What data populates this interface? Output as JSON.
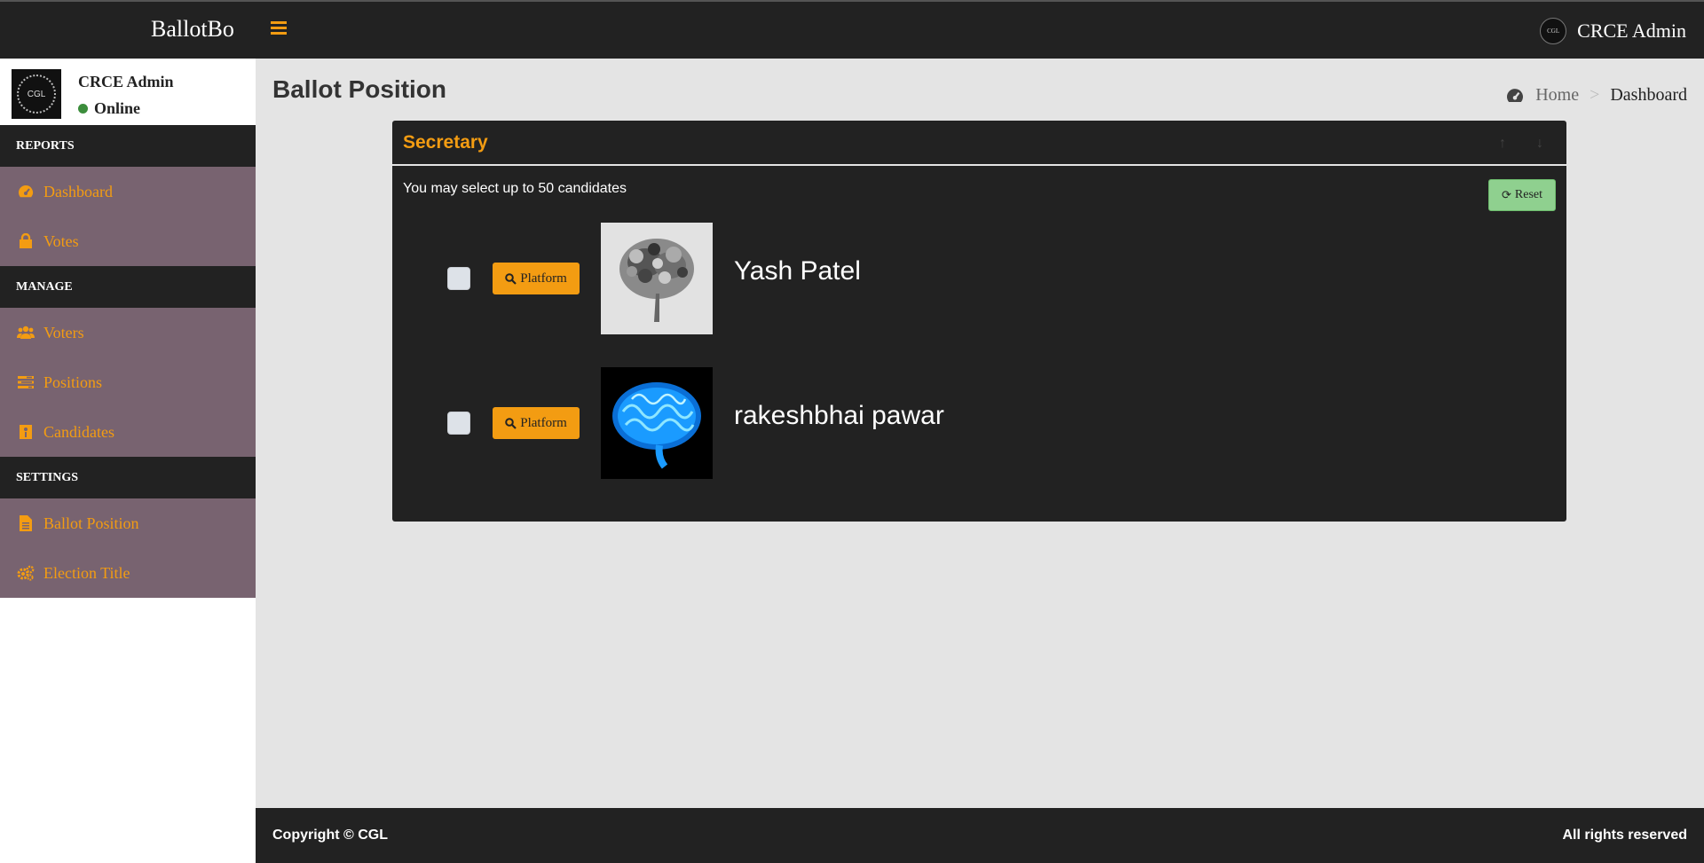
{
  "app": {
    "brand": "BallotBo",
    "user": "CRCE Admin",
    "avatar_text": "CGL"
  },
  "sidebar": {
    "user_name": "CRCE Admin",
    "status": "Online",
    "sections": [
      {
        "header": "REPORTS",
        "items": [
          {
            "label": "Dashboard",
            "icon": "dashboard-icon"
          },
          {
            "label": "Votes",
            "icon": "lock-icon"
          }
        ]
      },
      {
        "header": "MANAGE",
        "items": [
          {
            "label": "Voters",
            "icon": "users-icon"
          },
          {
            "label": "Positions",
            "icon": "tasks-icon"
          },
          {
            "label": "Candidates",
            "icon": "candidate-icon"
          }
        ]
      },
      {
        "header": "SETTINGS",
        "items": [
          {
            "label": "Ballot Position",
            "icon": "file-icon"
          },
          {
            "label": "Election Title",
            "icon": "cogs-icon"
          }
        ]
      }
    ]
  },
  "main": {
    "title": "Ballot Position",
    "breadcrumb": {
      "home": "Home",
      "current": "Dashboard"
    },
    "position": {
      "title": "Secretary",
      "instruction": "You may select up to 50 candidates",
      "reset_label": "Reset",
      "candidates": [
        {
          "name": "Yash Patel",
          "platform_label": "Platform",
          "photo": "metal-brain"
        },
        {
          "name": "rakeshbhai pawar",
          "platform_label": "Platform",
          "photo": "blue-brain"
        }
      ]
    }
  },
  "footer": {
    "left": "Copyright © CGL",
    "right": "All rights reserved"
  },
  "colors": {
    "accent": "#f39c12",
    "dark": "#222222",
    "sidebar_item_bg": "#786370",
    "reset_green": "#8fd08f"
  }
}
